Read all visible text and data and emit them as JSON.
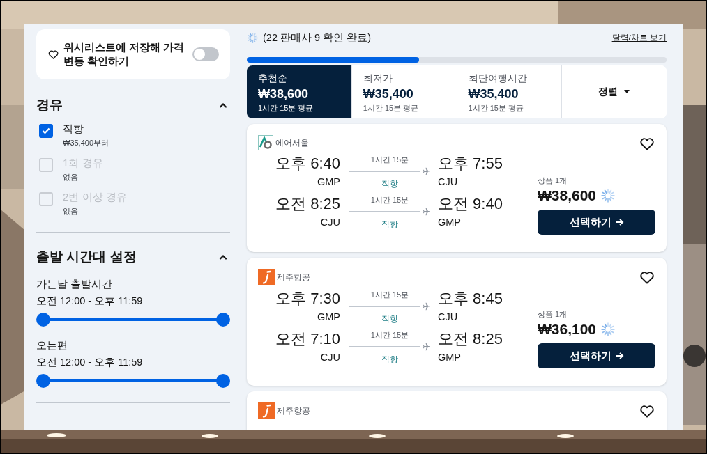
{
  "wishlist": {
    "text": "위시리스트에 저장해 가격 변동 확인하기",
    "on": false
  },
  "stops": {
    "title": "경유",
    "expanded": true,
    "options": [
      {
        "label": "직항",
        "sub": "₩35,400부터",
        "checked": true,
        "disabled": false
      },
      {
        "label": "1회 경유",
        "sub": "없음",
        "checked": false,
        "disabled": true
      },
      {
        "label": "2번 이상 경유",
        "sub": "없음",
        "checked": false,
        "disabled": true
      }
    ]
  },
  "departure_times": {
    "title": "출발 시간대 설정",
    "expanded": true,
    "ranges": [
      {
        "label": "가는날 출발시간",
        "range": "오전 12:00 - 오후 11:59",
        "level": 1
      },
      {
        "label": "오는편",
        "range": "오전 12:00 - 오후 11:59",
        "level": 1
      }
    ]
  },
  "status": {
    "text": "(22 판매사 9 확인 완료)",
    "link": "달력/차트 보기",
    "level": 0.41
  },
  "sort_tabs": [
    {
      "label": "추천순",
      "price": "₩38,600",
      "sub": "1시간 15분 평균",
      "selected": true
    },
    {
      "label": "최저가",
      "price": "₩35,400",
      "sub": "1시간 15분 평균",
      "selected": false
    },
    {
      "label": "최단여행시간",
      "price": "₩35,400",
      "sub": "1시간 15분 평균",
      "selected": false
    }
  ],
  "sort_button": "정렬",
  "results": [
    {
      "airline": "에어서울",
      "kind": "teal",
      "legs": [
        {
          "dep_time": "오후 6:40",
          "dep_code": "GMP",
          "duration": "1시간 15분",
          "stops": "직항",
          "arr_time": "오후 7:55",
          "arr_code": "CJU"
        },
        {
          "dep_time": "오전 8:25",
          "dep_code": "CJU",
          "duration": "1시간 15분",
          "stops": "직항",
          "arr_time": "오전 9:40",
          "arr_code": "GMP"
        }
      ],
      "count": "상품 1개",
      "price": "₩38,600",
      "button": "선택하기"
    },
    {
      "airline": "제주항공",
      "kind": "orange",
      "legs": [
        {
          "dep_time": "오후 7:30",
          "dep_code": "GMP",
          "duration": "1시간 15분",
          "stops": "직항",
          "arr_time": "오후 8:45",
          "arr_code": "CJU"
        },
        {
          "dep_time": "오전 7:10",
          "dep_code": "CJU",
          "duration": "1시간 15분",
          "stops": "직항",
          "arr_time": "오전 8:25",
          "arr_code": "GMP"
        }
      ],
      "count": "상품 1개",
      "price": "₩36,100",
      "button": "선택하기"
    },
    {
      "airline": "제주항공",
      "kind": "orange"
    }
  ]
}
